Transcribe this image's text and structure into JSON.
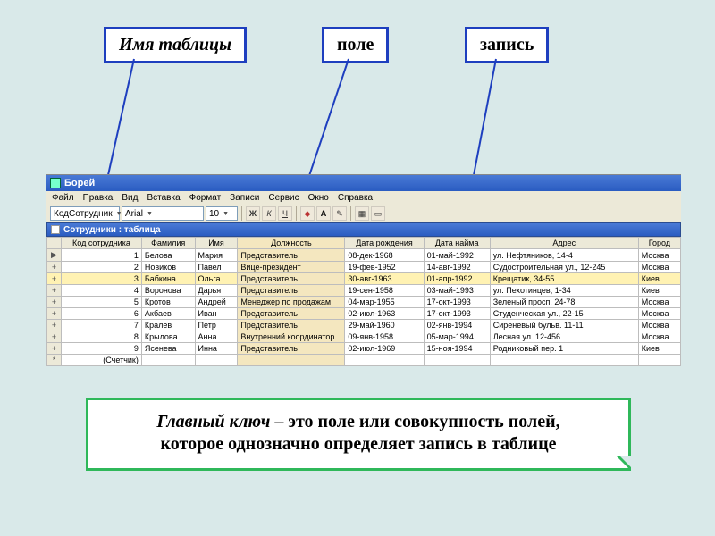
{
  "labels": {
    "table_name": "Имя таблицы",
    "field": "поле",
    "record": "запись"
  },
  "window": {
    "title": "Борей",
    "menu": [
      "Файл",
      "Правка",
      "Вид",
      "Вставка",
      "Формат",
      "Записи",
      "Сервис",
      "Окно",
      "Справка"
    ],
    "combo_field": "КодСотрудник",
    "combo_font": "Arial",
    "combo_size": "10",
    "fmt_bold": "Ж",
    "fmt_italic": "К",
    "fmt_underline": "Ч",
    "subwindow_title": "Сотрудники : таблица"
  },
  "columns": [
    "Код сотрудника",
    "Фамилия",
    "Имя",
    "Должность",
    "Дата рождения",
    "Дата найма",
    "Адрес",
    "Город"
  ],
  "rows": [
    {
      "id": "1",
      "fam": "Белова",
      "name": "Мария",
      "pos": "Представитель",
      "dob": "08-дек-1968",
      "hire": "01-май-1992",
      "addr": "ул. Нефтяников, 14-4",
      "city": "Москва",
      "sel": false,
      "marker": "▶"
    },
    {
      "id": "2",
      "fam": "Новиков",
      "name": "Павел",
      "pos": "Вице-президент",
      "dob": "19-фев-1952",
      "hire": "14-авг-1992",
      "addr": "Судостроительная ул., 12-245",
      "city": "Москва",
      "sel": false,
      "marker": "+"
    },
    {
      "id": "3",
      "fam": "Бабкина",
      "name": "Ольга",
      "pos": "Представитель",
      "dob": "30-авг-1963",
      "hire": "01-апр-1992",
      "addr": "Крещатик, 34-55",
      "city": "Киев",
      "sel": true,
      "marker": "+"
    },
    {
      "id": "4",
      "fam": "Воронова",
      "name": "Дарья",
      "pos": "Представитель",
      "dob": "19-сен-1958",
      "hire": "03-май-1993",
      "addr": "ул. Пехотинцев, 1-34",
      "city": "Киев",
      "sel": false,
      "marker": "+"
    },
    {
      "id": "5",
      "fam": "Кротов",
      "name": "Андрей",
      "pos": "Менеджер по продажам",
      "dob": "04-мар-1955",
      "hire": "17-окт-1993",
      "addr": "Зеленый просп. 24-78",
      "city": "Москва",
      "sel": false,
      "marker": "+"
    },
    {
      "id": "6",
      "fam": "Акбаев",
      "name": "Иван",
      "pos": "Представитель",
      "dob": "02-июл-1963",
      "hire": "17-окт-1993",
      "addr": "Студенческая ул., 22-15",
      "city": "Москва",
      "sel": false,
      "marker": "+"
    },
    {
      "id": "7",
      "fam": "Кралев",
      "name": "Петр",
      "pos": "Представитель",
      "dob": "29-май-1960",
      "hire": "02-янв-1994",
      "addr": "Сиреневый бульв. 11-11",
      "city": "Москва",
      "sel": false,
      "marker": "+"
    },
    {
      "id": "8",
      "fam": "Крылова",
      "name": "Анна",
      "pos": "Внутренний координатор",
      "dob": "09-янв-1958",
      "hire": "05-мар-1994",
      "addr": "Лесная ул. 12-456",
      "city": "Москва",
      "sel": false,
      "marker": "+"
    },
    {
      "id": "9",
      "fam": "Ясенева",
      "name": "Инна",
      "pos": "Представитель",
      "dob": "02-июл-1969",
      "hire": "15-ноя-1994",
      "addr": "Родниковый пер. 1",
      "city": "Киев",
      "sel": false,
      "marker": "+"
    }
  ],
  "new_row_label": "(Счетчик)",
  "new_row_marker": "*",
  "note": {
    "lead": "Главный ключ",
    "mid": " – это поле или совокупность полей,",
    "tail": "которое однозначно определяет запись в таблице"
  }
}
